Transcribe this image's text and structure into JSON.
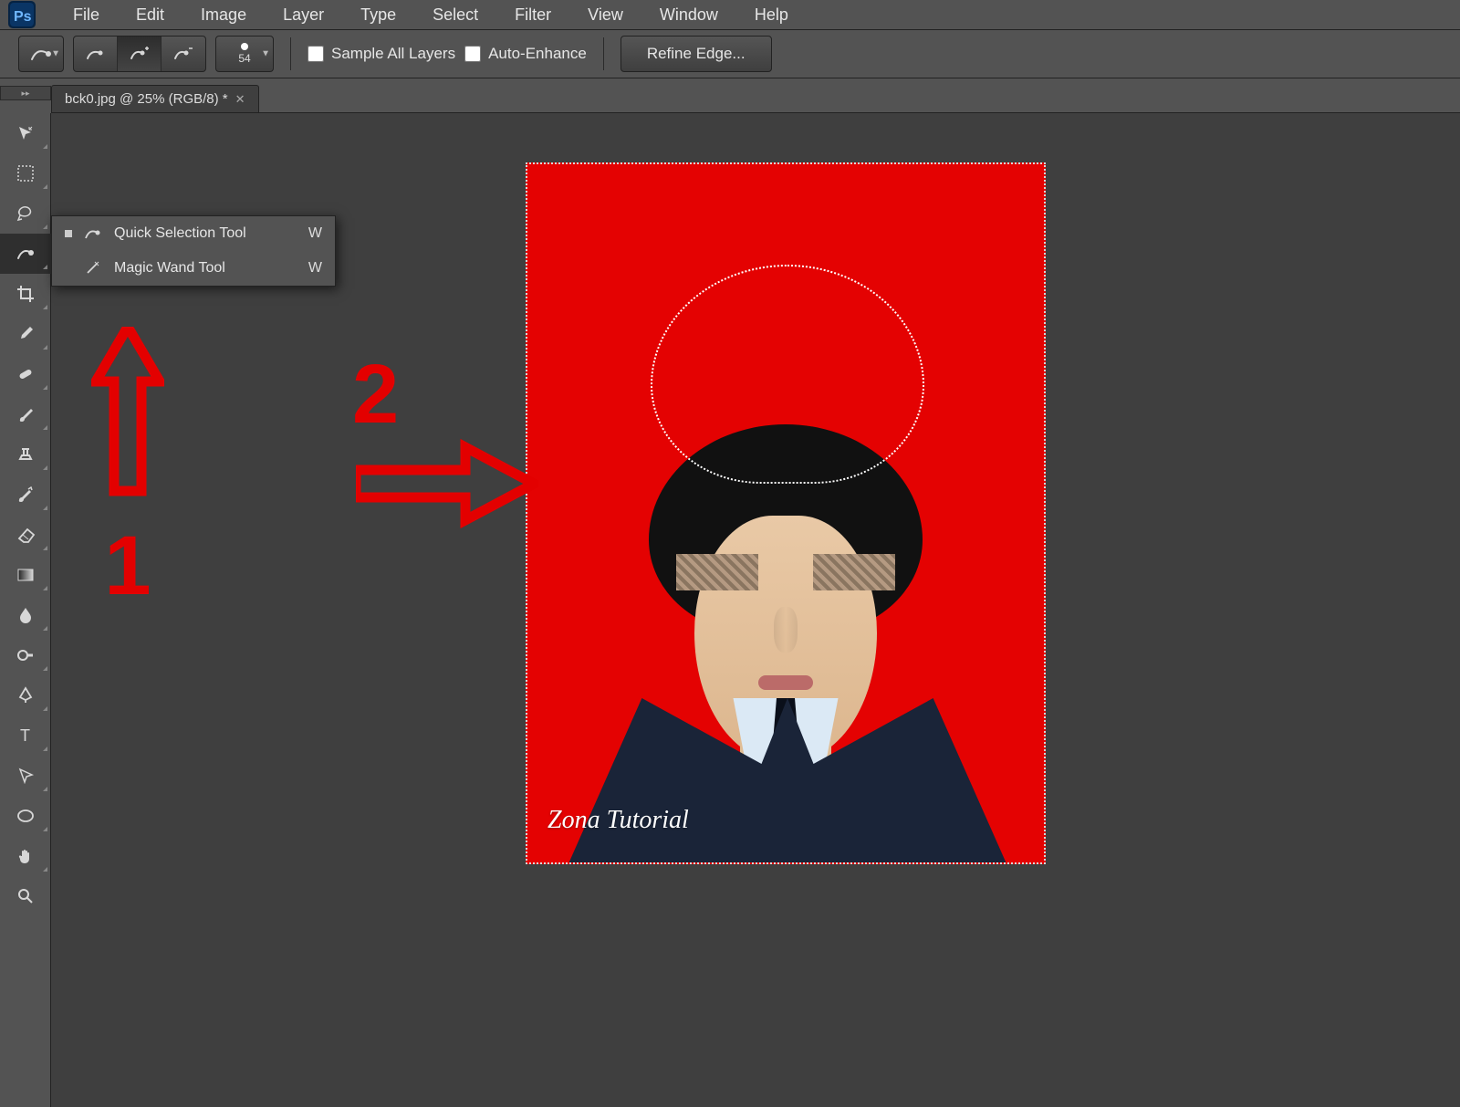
{
  "app": {
    "name": "Ps",
    "menus": [
      "File",
      "Edit",
      "Image",
      "Layer",
      "Type",
      "Select",
      "Filter",
      "View",
      "Window",
      "Help"
    ]
  },
  "options": {
    "brush_size": "54",
    "chk1": "Sample All Layers",
    "chk2": "Auto-Enhance",
    "refine": "Refine Edge..."
  },
  "tab": {
    "title": "bck0.jpg @ 25% (RGB/8) *"
  },
  "flyout": {
    "items": [
      {
        "label": "Quick Selection Tool",
        "key": "W",
        "active": true
      },
      {
        "label": "Magic Wand Tool",
        "key": "W",
        "active": false
      }
    ]
  },
  "tools": [
    "move",
    "marquee",
    "lasso",
    "quick-select",
    "crop",
    "eyedropper",
    "healing",
    "brush",
    "stamp",
    "history-brush",
    "eraser",
    "gradient",
    "blur",
    "dodge",
    "pen",
    "type",
    "path-select",
    "ellipse",
    "hand",
    "zoom"
  ],
  "annotations": {
    "one": "1",
    "two": "2"
  },
  "canvas": {
    "watermark": "Zona Tutorial",
    "bg": "#e40202"
  }
}
